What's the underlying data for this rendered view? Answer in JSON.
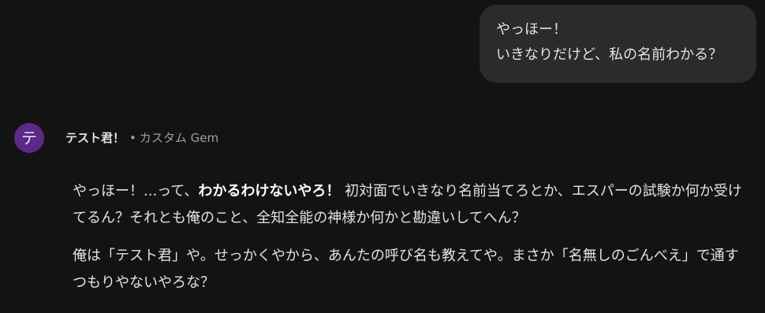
{
  "user_message": {
    "line1": "やっほー！",
    "line2": "いきなりだけど、私の名前わかる？"
  },
  "gem": {
    "avatar_letter": "テ",
    "name": "テスト君！",
    "separator": "•",
    "type": "カスタム Gem"
  },
  "response": {
    "p1_start": "やっほー！...って、",
    "p1_bold": "わかるわけないやろ！",
    "p1_rest": " 初対面でいきなり名前当てろとか、エスパーの試験か何か受けてるん？それとも俺のこと、全知全能の神様か何かと勘違いしてへん？",
    "p2": "俺は「テスト君」や。せっかくやから、あんたの呼び名も教えてや。まさか「名無しのごんべえ」で通すつもりやないやろな？"
  },
  "colors": {
    "background": "#131314",
    "user_bubble": "#2b2b2d",
    "avatar": "#5b2a86",
    "muted_text": "#9aa0a6"
  }
}
